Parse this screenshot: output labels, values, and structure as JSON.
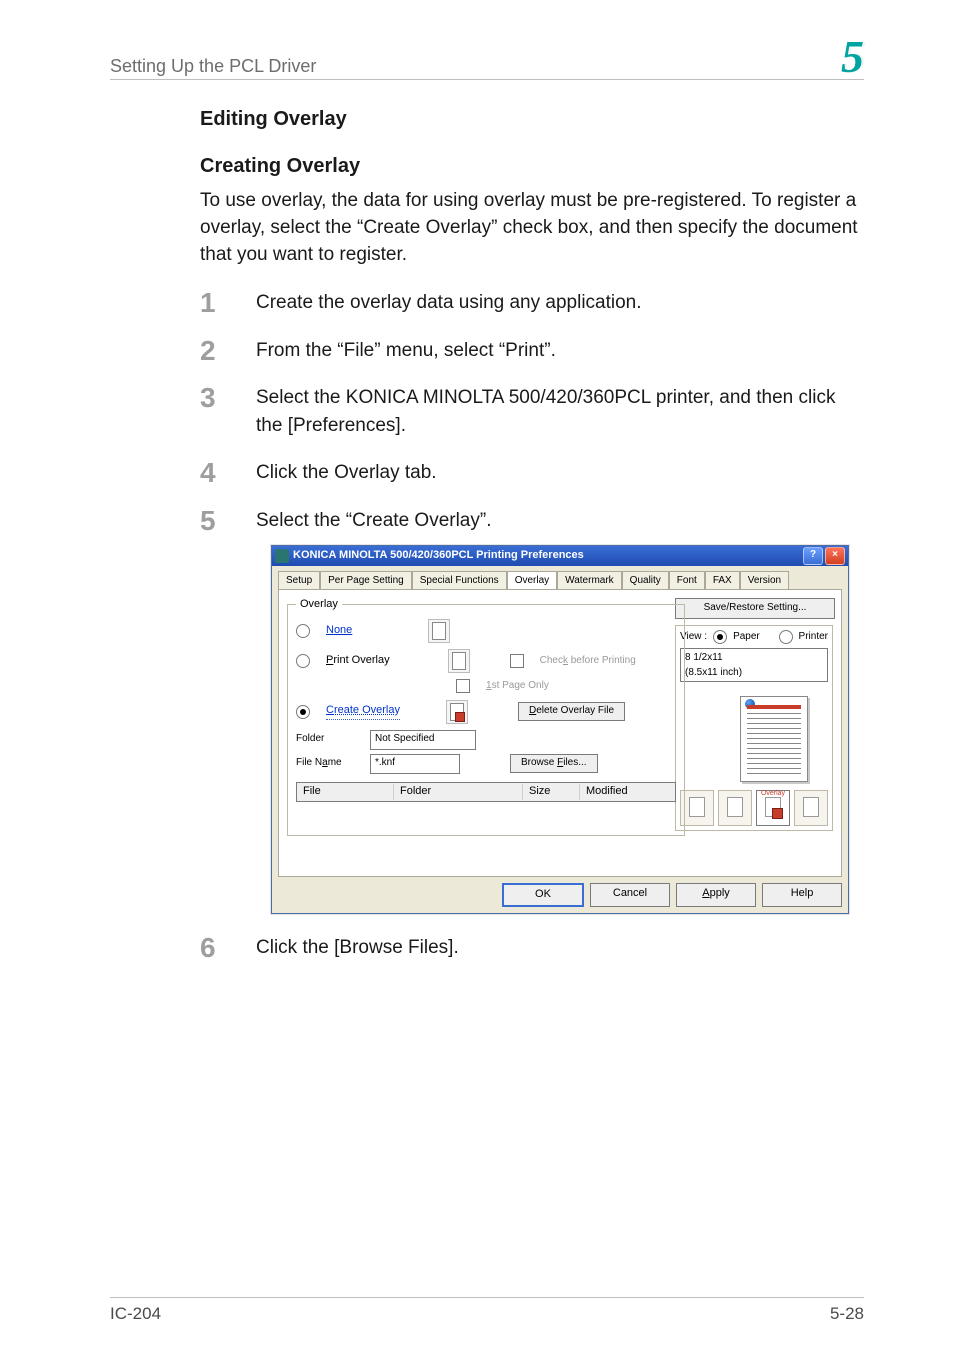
{
  "page": {
    "running_head": "Setting Up the PCL Driver",
    "chapter_number": "5",
    "heading_editing_overlay": "Editing Overlay",
    "heading_creating_overlay": "Creating Overlay",
    "intro": "To use overlay, the data for using overlay must be pre-registered. To register a overlay, select the “Create Overlay” check box, and then specify the document that you want to register.",
    "steps": [
      "Create the overlay data using any application.",
      "From the “File” menu, select “Print”.",
      "Select the KONICA MINOLTA 500/420/360PCL printer, and then click the [Preferences].",
      "Click the Overlay tab.",
      "Select the “Create Overlay”.",
      "Click the [Browse Files]."
    ],
    "footer_left": "IC-204",
    "footer_right": "5-28"
  },
  "dialog": {
    "title": "KONICA MINOLTA 500/420/360PCL Printing Preferences",
    "help_btn": "?",
    "close_btn": "×",
    "tabs": [
      "Setup",
      "Per Page Setting",
      "Special Functions",
      "Overlay",
      "Watermark",
      "Quality",
      "Font",
      "FAX",
      "Version"
    ],
    "active_tab_index": 3,
    "group_label": "Overlay",
    "radios": {
      "none": "None",
      "print_overlay": "Print Overlay",
      "create_overlay": "Create Overlay"
    },
    "checks": {
      "check_before": "Check before Printing",
      "first_page": "1st Page Only"
    },
    "buttons": {
      "delete_overlay_file": "Delete Overlay File",
      "browse_files": "Browse Files..."
    },
    "fields": {
      "folder_label": "Folder",
      "folder_value": "Not Specified",
      "filename_label": "File Name",
      "filename_value": "*.knf"
    },
    "list_headers": [
      "File",
      "Folder",
      "Size",
      "Modified"
    ],
    "right": {
      "save_restore": "Save/Restore Setting...",
      "view_label": "View :",
      "option_paper": "Paper",
      "option_printer": "Printer",
      "paper_dim_top": "8 1/2x11",
      "paper_dim_sub": "(8.5x11 inch)",
      "overlay_caption": "Overlay"
    },
    "footer_buttons": {
      "ok": "OK",
      "cancel": "Cancel",
      "apply": "Apply",
      "help": "Help"
    }
  }
}
